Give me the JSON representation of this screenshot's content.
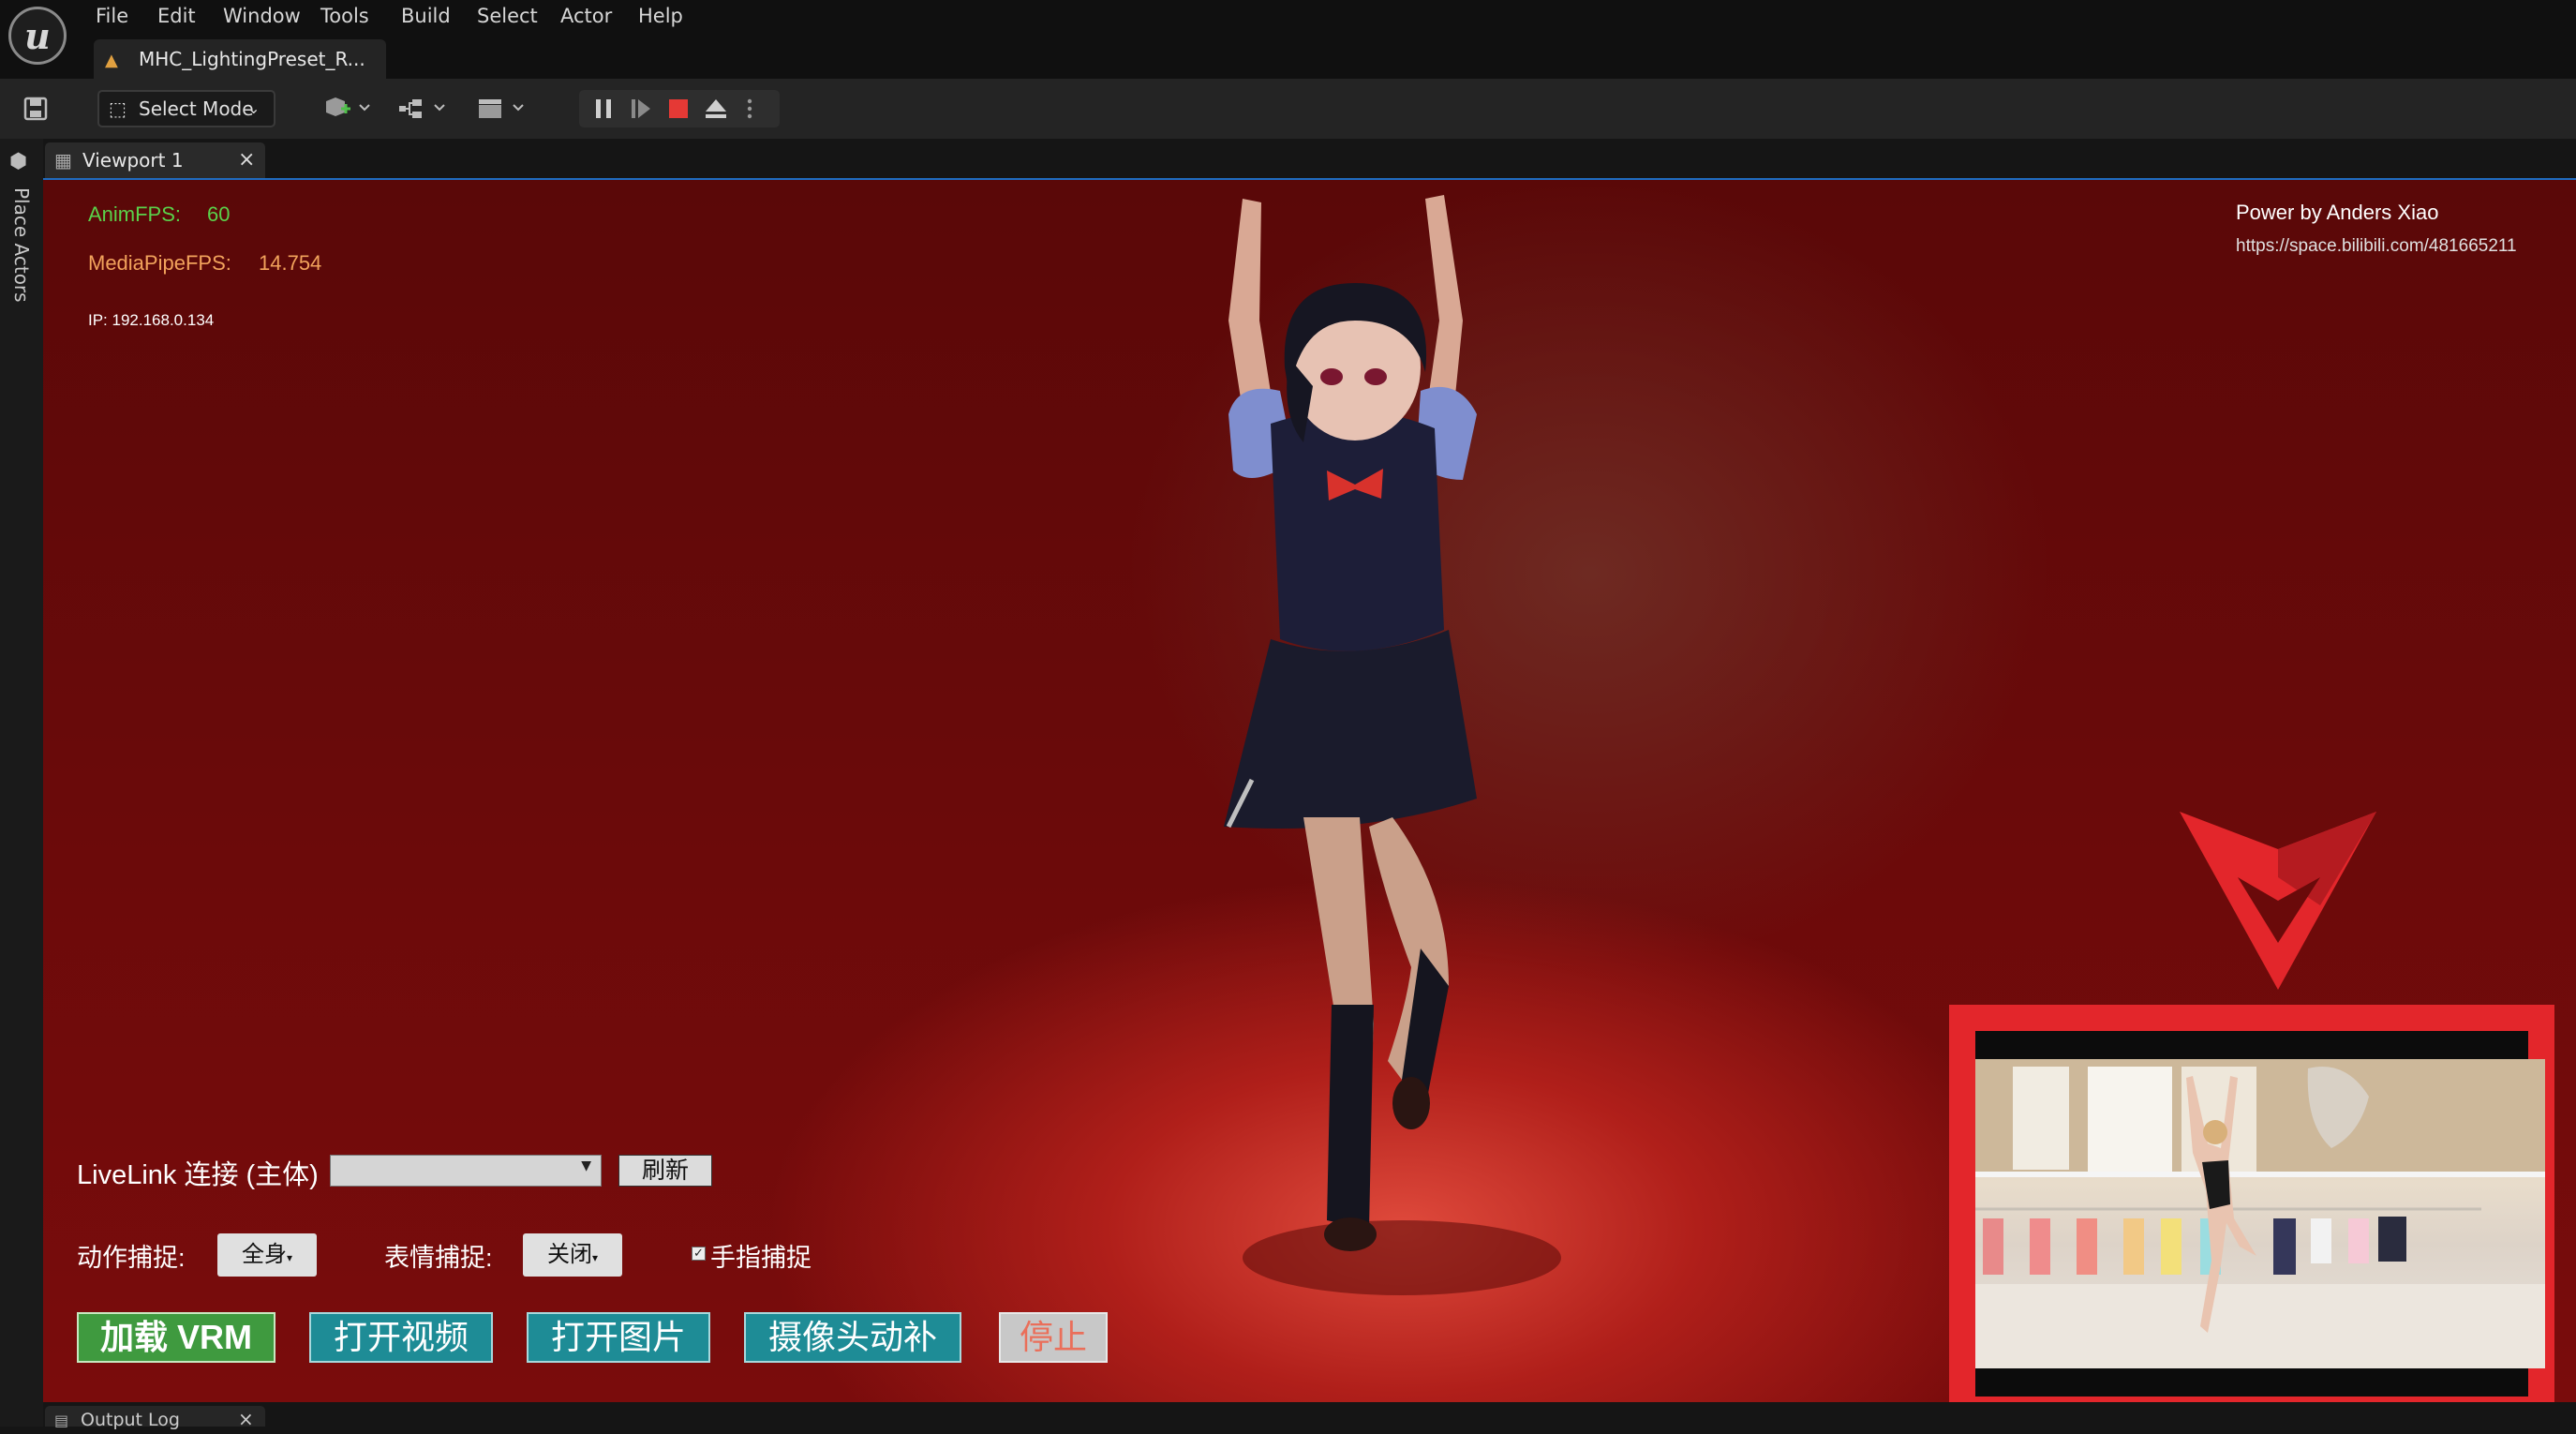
{
  "menu": {
    "logo_glyph": "u",
    "items": [
      "File",
      "Edit",
      "Window",
      "Tools",
      "Build",
      "Select",
      "Actor",
      "Help"
    ]
  },
  "document_tab": {
    "label": "MHC_LightingPreset_R..."
  },
  "toolbar": {
    "select_mode_label": "Select Mode"
  },
  "left_panel": {
    "place_actors_label": "Place Actors"
  },
  "viewport_tab": {
    "label": "Viewport 1",
    "close": "×"
  },
  "hud": {
    "anim_fps_label": "AnimFPS:",
    "anim_fps_value": "60",
    "mediapipe_fps_label": "MediaPipeFPS:",
    "mediapipe_fps_value": "14.754",
    "ip": "IP: 192.168.0.134",
    "credit": "Power by Anders Xiao",
    "credit_url": "https://space.bilibili.com/481665211"
  },
  "controls": {
    "livelink_label": "LiveLink 连接 (主体)",
    "livelink_value": "",
    "refresh_label": "刷新",
    "motion_label": "动作捕捉:",
    "motion_value": "全身",
    "face_label": "表情捕捉:",
    "face_value": "关闭",
    "finger_label": "手指捕捉",
    "finger_checked": true,
    "load_vrm_label": "加载 VRM",
    "open_video_label": "打开视频",
    "open_image_label": "打开图片",
    "camera_label": "摄像头动补",
    "stop_label": "停止"
  },
  "output_log": {
    "label": "Output Log",
    "close": "×"
  },
  "colors": {
    "accent_red": "#e3262b",
    "anim_fps": "#5ad14a",
    "mediapipe_fps": "#f2a35c",
    "vrm_button": "#3f9a3f",
    "teal_button": "#1e8c96",
    "stop_text": "#ea6f5a"
  }
}
